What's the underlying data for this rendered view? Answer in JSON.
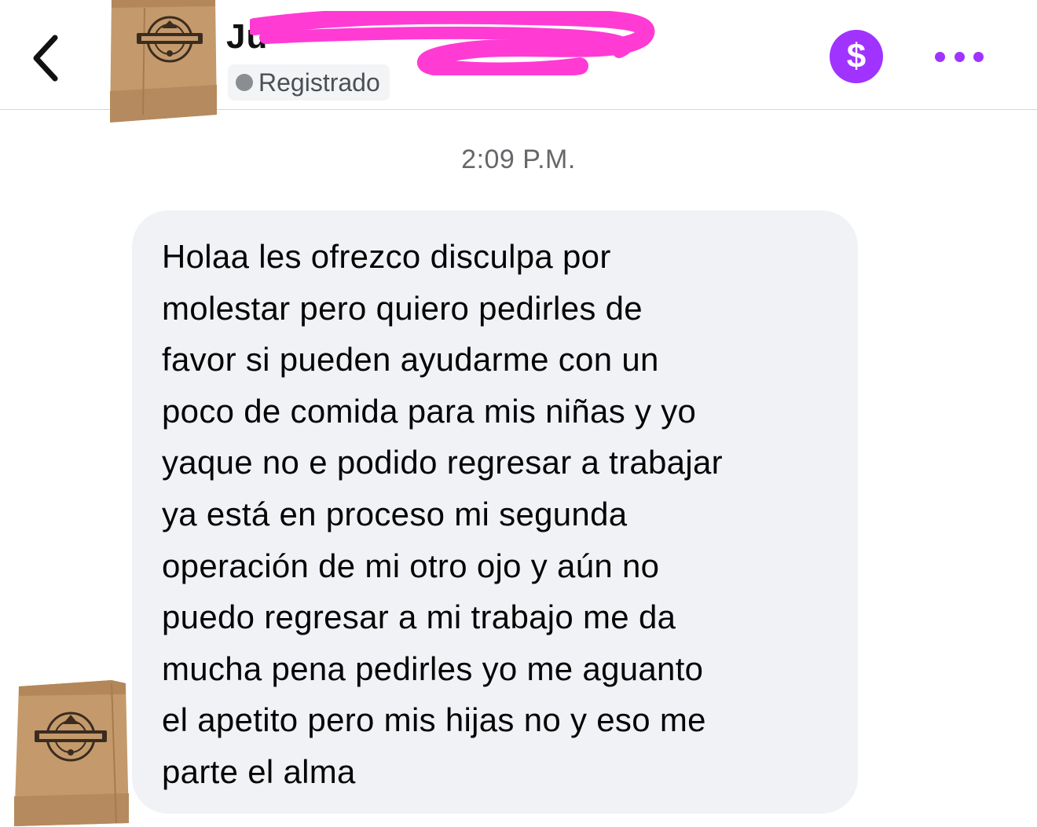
{
  "header": {
    "back_icon": "chevron-left-icon",
    "avatar_icon": "paper-bag-logo-icon",
    "contact_name": "Ju",
    "status_text": "Registrado",
    "payment_icon": "dollar-icon",
    "more_icon": "more-horizontal-icon"
  },
  "conversation": {
    "timestamp": "2:09 P.M.",
    "messages": [
      {
        "text": "Holaa les ofrezco disculpa por\nmolestar pero quiero pedirles de\nfavor si pueden ayudarme con un\npoco de comida para mis niñas y yo\nyaque no e podido regresar a trabajar\nya está en proceso mi segunda\noperación de mi otro ojo y aún no\npuedo regresar a mi trabajo me da\nmucha pena pedirles yo me aguanto\nel apetito pero mis hijas no y eso me\nparte el alma"
      }
    ]
  },
  "colors": {
    "accent": "#a033ff",
    "bubble_bg": "#f0f2f5",
    "status_dot": "#8a8d91",
    "redaction": "#ff3bd4",
    "bag": "#c49a6c"
  }
}
